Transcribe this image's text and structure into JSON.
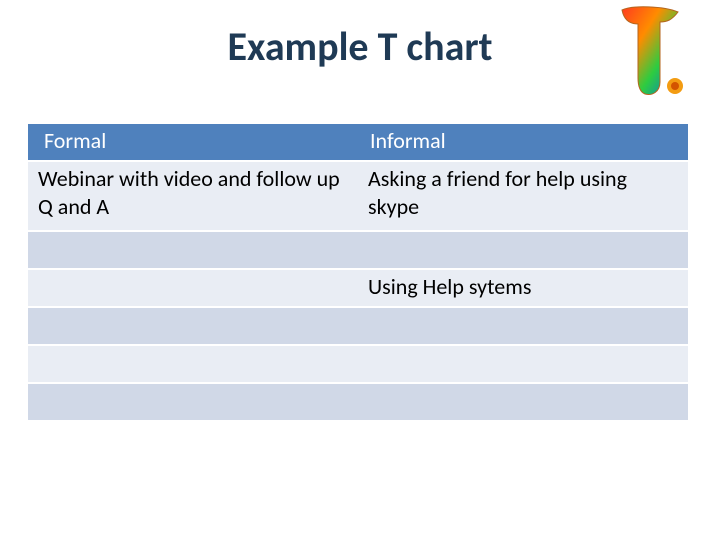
{
  "title": "Example T chart",
  "decor": {
    "letter_icon": "T"
  },
  "table": {
    "headers": {
      "left": " Formal",
      "right": "Informal"
    },
    "rows": [
      {
        "left": "Webinar with video and follow up Q and A",
        "right": "Asking a friend for help using skype"
      },
      {
        "left": "",
        "right": ""
      },
      {
        "left": "",
        "right": "Using Help sytems"
      },
      {
        "left": "",
        "right": ""
      },
      {
        "left": "",
        "right": ""
      },
      {
        "left": "",
        "right": ""
      }
    ]
  }
}
